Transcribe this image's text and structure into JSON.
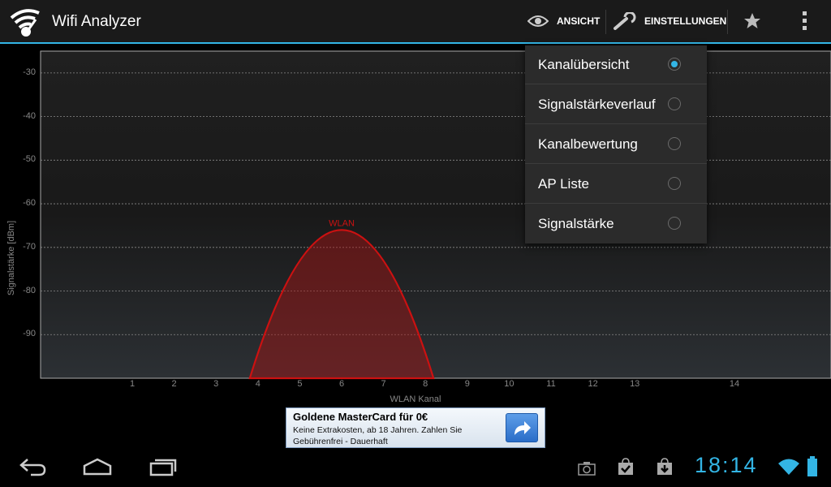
{
  "app": {
    "title": "Wifi Analyzer"
  },
  "actions": {
    "view_label": "ANSICHT",
    "settings_label": "EINSTELLUNGEN"
  },
  "menu": {
    "items": [
      {
        "label": "Kanalübersicht",
        "selected": true
      },
      {
        "label": "Signalstärkeverlauf",
        "selected": false
      },
      {
        "label": "Kanalbewertung",
        "selected": false
      },
      {
        "label": "AP Liste",
        "selected": false
      },
      {
        "label": "Signalstärke",
        "selected": false
      }
    ]
  },
  "chart": {
    "ylabel": "Signalstärke [dBm]",
    "xlabel": "WLAN Kanal",
    "yticks": [
      "-30",
      "-40",
      "-50",
      "-60",
      "-70",
      "-80",
      "-90"
    ],
    "xticks": [
      "1",
      "2",
      "3",
      "4",
      "5",
      "6",
      "7",
      "8",
      "9",
      "10",
      "11",
      "12",
      "13",
      "14"
    ],
    "network_label": "WLAN",
    "network_color": "#cc1111"
  },
  "chart_data": {
    "type": "area",
    "xlabel": "WLAN Kanal",
    "ylabel": "Signalstärke [dBm]",
    "ylim": [
      -100,
      -25
    ],
    "series": [
      {
        "name": "WLAN",
        "channel": 6,
        "peak_dbm": -66,
        "channel_range": [
          4,
          8
        ]
      }
    ],
    "grid": true
  },
  "ad": {
    "title": "Goldene MasterCard für 0€",
    "text": "Keine Extrakosten, ab 18 Jahren. Zahlen Sie Gebührenfrei - Dauerhaft"
  },
  "system": {
    "clock": "18:14"
  }
}
